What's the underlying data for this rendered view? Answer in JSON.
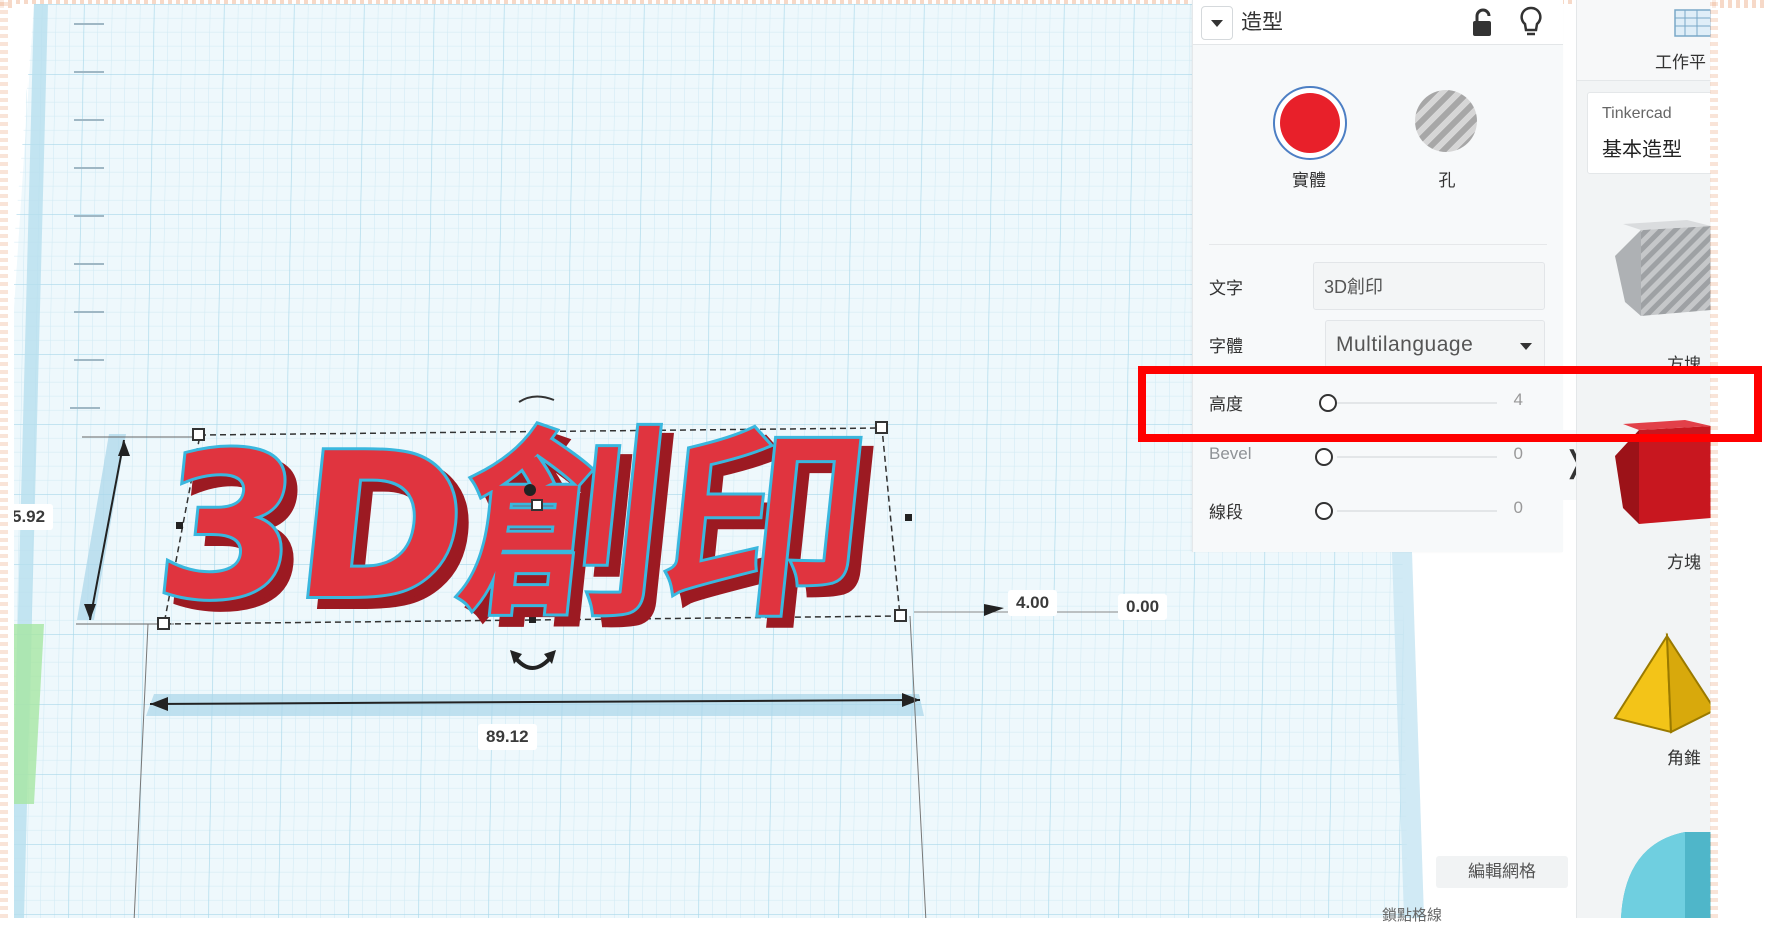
{
  "workplane": {
    "object_text": "3D創印",
    "dimensions": {
      "height_left": "5.92",
      "length": "89.12",
      "elevation": "4.00",
      "offset": "0.00"
    }
  },
  "properties_panel": {
    "title": "造型",
    "modes": {
      "solid": "實體",
      "hole": "孔"
    },
    "text_label": "文字",
    "text_value": "3D創印",
    "font_label": "字體",
    "font_value": "Multilanguage",
    "height_label": "高度",
    "height_value": "4",
    "bevel_label": "Bevel",
    "bevel_value": "0",
    "segments_label": "線段",
    "segments_value": "0"
  },
  "library": {
    "workplane_label": "工作平",
    "category_source": "Tinkercad",
    "category_name": "基本造型",
    "shapes": [
      {
        "label": "方塊",
        "icon": "box-hole-icon"
      },
      {
        "label": "方塊",
        "icon": "box-icon"
      },
      {
        "label": "角錐",
        "icon": "pyramid-icon"
      },
      {
        "label": "",
        "icon": "roof-icon"
      }
    ]
  },
  "controls": {
    "edit_grid": "編輯網格",
    "snap_grid": "鎖點格線"
  },
  "colors": {
    "solid": "#e8202a",
    "highlight": "#ff0000",
    "grid": "#bfe3f0",
    "text_outline": "#3ab7de"
  }
}
